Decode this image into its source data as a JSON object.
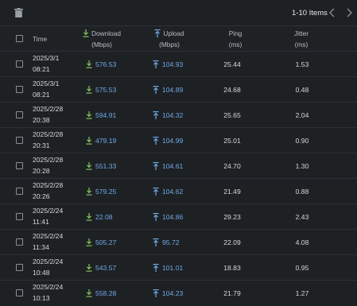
{
  "toolbar": {
    "pager_text": "1-10 Items"
  },
  "headers": {
    "time": "Time",
    "download": "Download",
    "download_unit": "(Mbps)",
    "upload": "Upload",
    "upload_unit": "(Mbps)",
    "ping": "Ping",
    "ping_unit": "(ms)",
    "jitter": "Jitter",
    "jitter_unit": "(ms)"
  },
  "colors": {
    "download_icon": "#83c55a",
    "upload_icon": "#6fa9e8",
    "value_blue": "#6fa9e8"
  },
  "rows": [
    {
      "date": "2025/3/1",
      "time": "08:21",
      "download": "576.53",
      "upload": "104.93",
      "ping": "25.44",
      "jitter": "1.53"
    },
    {
      "date": "2025/3/1",
      "time": "08:21",
      "download": "575.53",
      "upload": "104.89",
      "ping": "24.68",
      "jitter": "0.48"
    },
    {
      "date": "2025/2/28",
      "time": "20:38",
      "download": "594.91",
      "upload": "104.32",
      "ping": "25.65",
      "jitter": "2.04"
    },
    {
      "date": "2025/2/28",
      "time": "20:31",
      "download": "479.19",
      "upload": "104.99",
      "ping": "25.01",
      "jitter": "0.90"
    },
    {
      "date": "2025/2/28",
      "time": "20:28",
      "download": "551.33",
      "upload": "104.61",
      "ping": "24.70",
      "jitter": "1.30"
    },
    {
      "date": "2025/2/28",
      "time": "20:26",
      "download": "579.25",
      "upload": "104.62",
      "ping": "21.49",
      "jitter": "0.88"
    },
    {
      "date": "2025/2/24",
      "time": "11:41",
      "download": "22.08",
      "upload": "104.86",
      "ping": "29.23",
      "jitter": "2.43"
    },
    {
      "date": "2025/2/24",
      "time": "11:34",
      "download": "505.27",
      "upload": "95.72",
      "ping": "22.09",
      "jitter": "4.08"
    },
    {
      "date": "2025/2/24",
      "time": "10:48",
      "download": "543.57",
      "upload": "101.01",
      "ping": "18.83",
      "jitter": "0.95"
    },
    {
      "date": "2025/2/24",
      "time": "10:13",
      "download": "558.28",
      "upload": "104.23",
      "ping": "21.79",
      "jitter": "1.27"
    }
  ]
}
